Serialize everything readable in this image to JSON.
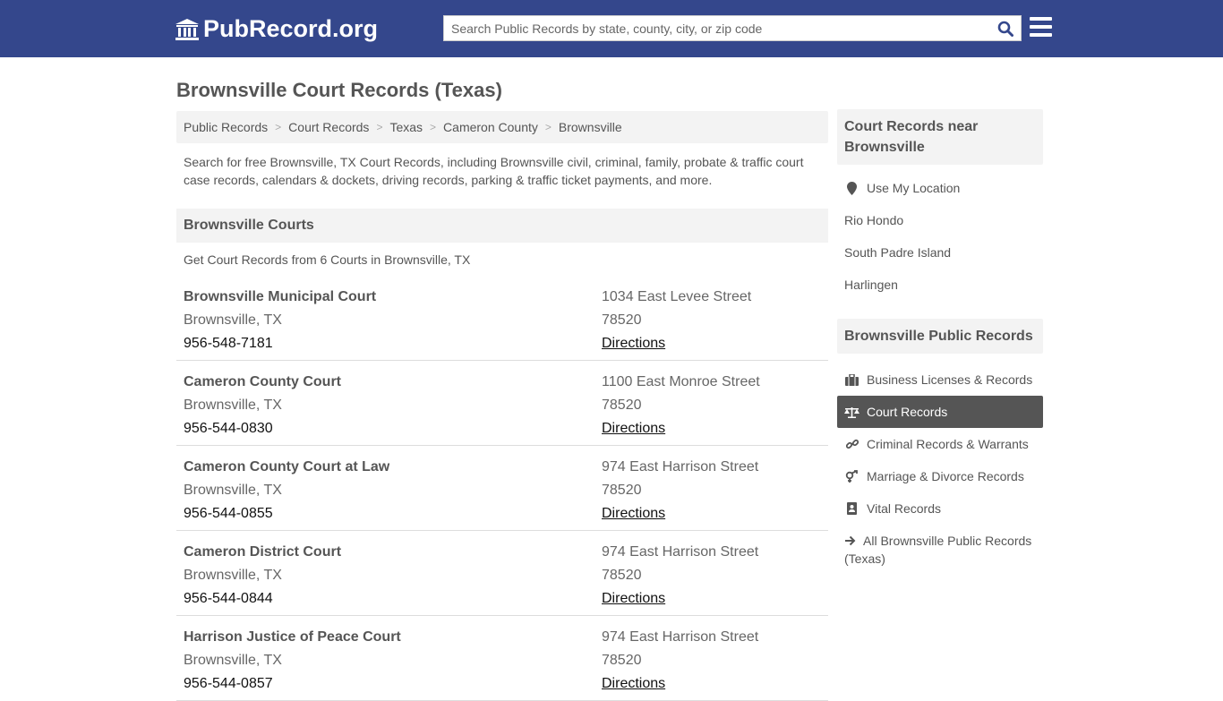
{
  "header": {
    "logo_text": "PubRecord.org",
    "search_placeholder": "Search Public Records by state, county, city, or zip code",
    "colors": {
      "topbar": "#34478c"
    }
  },
  "page_title": "Brownsville Court Records (Texas)",
  "breadcrumb": [
    "Public Records",
    "Court Records",
    "Texas",
    "Cameron County",
    "Brownsville"
  ],
  "intro": "Search for free Brownsville, TX Court Records, including Brownsville civil, criminal, family, probate & traffic court case records, calendars & dockets, driving records, parking & traffic ticket payments, and more.",
  "courts_section": {
    "title": "Brownsville Courts",
    "subtitle": "Get Court Records from 6 Courts in Brownsville, TX",
    "directions_label": "Directions",
    "courts": [
      {
        "name": "Brownsville Municipal Court",
        "city": "Brownsville, TX",
        "phone": "956-548-7181",
        "street": "1034 East Levee Street",
        "zip": "78520"
      },
      {
        "name": "Cameron County Court",
        "city": "Brownsville, TX",
        "phone": "956-544-0830",
        "street": "1100 East Monroe Street",
        "zip": "78520"
      },
      {
        "name": "Cameron County Court at Law",
        "city": "Brownsville, TX",
        "phone": "956-544-0855",
        "street": "974 East Harrison Street",
        "zip": "78520"
      },
      {
        "name": "Cameron District Court",
        "city": "Brownsville, TX",
        "phone": "956-544-0844",
        "street": "974 East Harrison Street",
        "zip": "78520"
      },
      {
        "name": "Harrison Justice of Peace Court",
        "city": "Brownsville, TX",
        "phone": "956-544-0857",
        "street": "974 East Harrison Street",
        "zip": "78520"
      }
    ]
  },
  "sidebar": {
    "nearby_title": "Court Records near Brownsville",
    "use_location": "Use My Location",
    "nearby": [
      "Rio Hondo",
      "South Padre Island",
      "Harlingen"
    ],
    "public_title": "Brownsville Public Records",
    "public_items": [
      {
        "label": "Business Licenses & Records",
        "icon": "briefcase-icon"
      },
      {
        "label": "Court Records",
        "icon": "scale-icon",
        "active": true
      },
      {
        "label": "Criminal Records & Warrants",
        "icon": "link-icon"
      },
      {
        "label": "Marriage & Divorce Records",
        "icon": "gender-icon"
      },
      {
        "label": "Vital Records",
        "icon": "contact-book-icon"
      }
    ],
    "all_link": "All Brownsville Public Records (Texas)"
  }
}
